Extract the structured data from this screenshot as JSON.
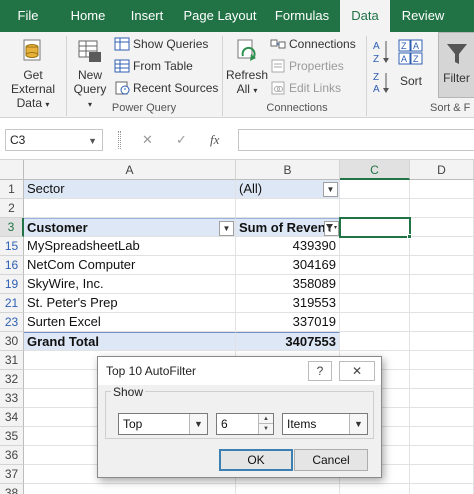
{
  "ribbon_tabs": [
    {
      "label": "File"
    },
    {
      "label": "Home"
    },
    {
      "label": "Insert"
    },
    {
      "label": "Page Layout"
    },
    {
      "label": "Formulas"
    },
    {
      "label": "Data"
    },
    {
      "label": "Review"
    }
  ],
  "ribbon": {
    "get_external_data": [
      "Get External",
      "Data"
    ],
    "new_query": [
      "New",
      "Query"
    ],
    "show_queries": "Show Queries",
    "from_table": "From Table",
    "recent_sources": "Recent Sources",
    "power_query_group": "Power Query",
    "refresh_all": [
      "Refresh",
      "All"
    ],
    "connections": "Connections",
    "properties": "Properties",
    "edit_links": "Edit Links",
    "connections_group": "Connections",
    "sort": "Sort",
    "filter": "Filter",
    "sort_filter_group": "Sort & F"
  },
  "formula_bar": {
    "name_box": "C3",
    "fx": "fx",
    "value": ""
  },
  "sheet": {
    "columns": [
      "A",
      "B",
      "C",
      "D"
    ],
    "rows": [
      {
        "num": "1",
        "a": "Sector",
        "b": "(All)"
      },
      {
        "num": "2",
        "a": "",
        "b": ""
      },
      {
        "num": "3",
        "a": "Customer",
        "b": "Sum of Revenue"
      },
      {
        "num": "15",
        "a": "MySpreadsheetLab",
        "b": "439390"
      },
      {
        "num": "16",
        "a": "NetCom Computer",
        "b": "304169"
      },
      {
        "num": "19",
        "a": "SkyWire, Inc.",
        "b": "358089"
      },
      {
        "num": "21",
        "a": "St. Peter's Prep",
        "b": "319553"
      },
      {
        "num": "23",
        "a": "Surten Excel",
        "b": "337019"
      },
      {
        "num": "30",
        "a": "Grand Total",
        "b": "3407553"
      },
      {
        "num": "31",
        "a": "",
        "b": ""
      },
      {
        "num": "32",
        "a": "",
        "b": ""
      },
      {
        "num": "33",
        "a": "",
        "b": ""
      },
      {
        "num": "34",
        "a": "",
        "b": ""
      },
      {
        "num": "35",
        "a": "",
        "b": ""
      },
      {
        "num": "36",
        "a": "",
        "b": ""
      },
      {
        "num": "37",
        "a": "",
        "b": ""
      },
      {
        "num": "38",
        "a": "",
        "b": ""
      }
    ]
  },
  "dialog": {
    "title": "Top 10 AutoFilter",
    "help": "?",
    "close": "✕",
    "show_label": "Show",
    "direction": "Top",
    "count": "6",
    "unit": "Items",
    "ok": "OK",
    "cancel": "Cancel"
  },
  "colors": {
    "accent": "#217346",
    "pivot_fill": "#dde7f5",
    "row_number_blue": "#2f5fb3"
  }
}
